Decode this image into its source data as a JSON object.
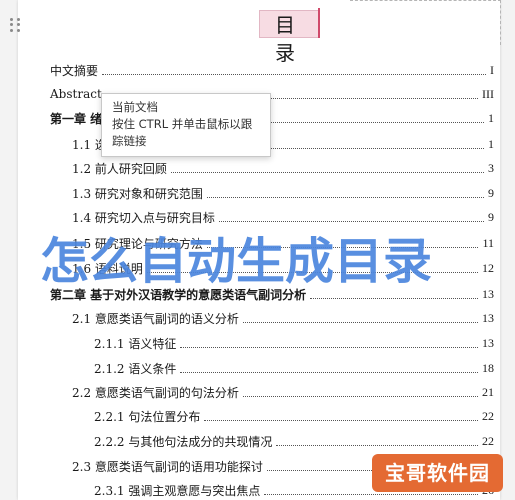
{
  "title": "目 录",
  "tooltip": {
    "line1": "当前文档",
    "line2": "按住 CTRL 并单击鼠标以跟",
    "line3": "踪链接"
  },
  "toc": [
    {
      "label": "中文摘要",
      "page": "I"
    },
    {
      "label": "Abstract",
      "page": "III"
    },
    {
      "label": "第一章  绪",
      "page": "1"
    },
    {
      "label": "1.1 选",
      "page": "1"
    },
    {
      "label": "1.2 前人研究回顾",
      "page": "3"
    },
    {
      "label": "1.3 研究对象和研究范围",
      "page": "9"
    },
    {
      "label": "1.4 研究切入点与研究目标",
      "page": "9"
    },
    {
      "label": "1.5 研究理论与研究方法",
      "page": "11"
    },
    {
      "label": "1.6 语料说明",
      "page": "12"
    },
    {
      "label": "第二章  基于对外汉语教学的意愿类语气副词分析",
      "page": "13"
    },
    {
      "label": "2.1 意愿类语气副词的语义分析",
      "page": "13"
    },
    {
      "label": "2.1.1 语义特征",
      "page": "13"
    },
    {
      "label": "2.1.2 语义条件",
      "page": "18"
    },
    {
      "label": "2.2 意愿类语气副词的句法分析",
      "page": "21"
    },
    {
      "label": "2.2.1 句法位置分布",
      "page": "22"
    },
    {
      "label": "2.2.2 与其他句法成分的共现情况",
      "page": "22"
    },
    {
      "label": "2.3 意愿类语气副词的语用功能探讨",
      "page": "26"
    },
    {
      "label": "2.3.1 强调主观意愿与突出焦点",
      "page": "26"
    }
  ],
  "watermark": "怎么自动生成目录",
  "logo_text": "宝哥软件园",
  "colors": {
    "watermark": "#3476d9",
    "title_highlight": "#f7dce3",
    "logo": "#e46a33"
  }
}
